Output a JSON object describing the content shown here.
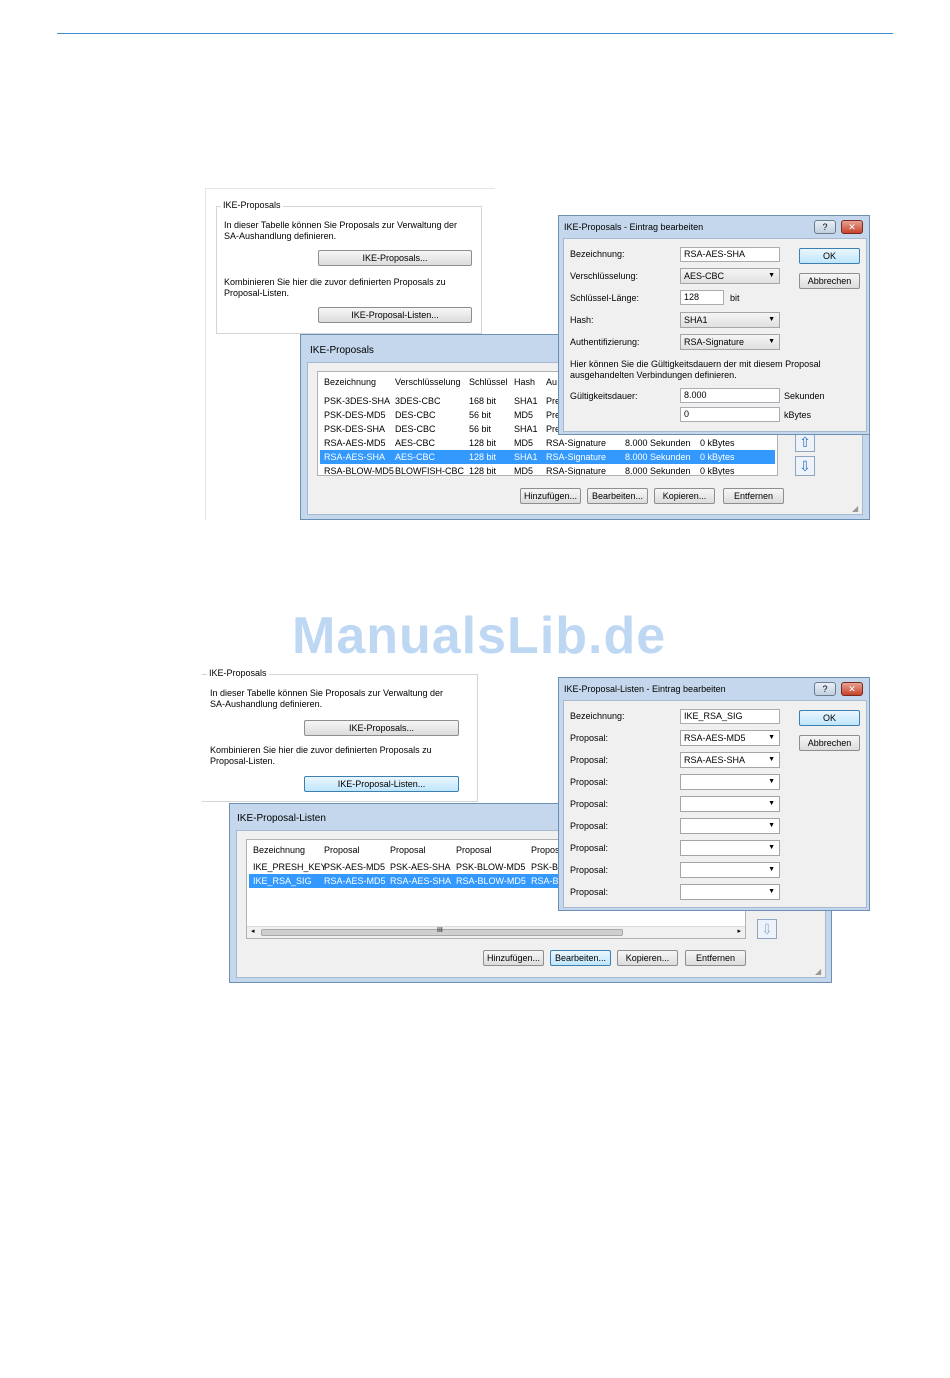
{
  "watermark": "ManualsLib.de",
  "fig1": {
    "group_title": "IKE-Proposals",
    "desc1": "In dieser Tabelle können Sie Proposals zur Verwaltung der SA-Aushandlung definieren.",
    "btn_proposals": "IKE-Proposals...",
    "desc2": "Kombinieren Sie hier die zuvor definierten Proposals zu Proposal-Listen.",
    "btn_lists": "IKE-Proposal-Listen...",
    "list_window": {
      "title": "IKE-Proposals",
      "headers": [
        "Bezeichnung",
        "Verschlüsselung",
        "Schlüssel",
        "Hash",
        "Au"
      ],
      "rows": [
        {
          "c": [
            "PSK-3DES-SHA",
            "3DES-CBC",
            "168 bit",
            "SHA1",
            "Pre",
            "",
            ""
          ]
        },
        {
          "c": [
            "PSK-DES-MD5",
            "DES-CBC",
            "56 bit",
            "MD5",
            "Pre",
            "",
            ""
          ]
        },
        {
          "c": [
            "PSK-DES-SHA",
            "DES-CBC",
            "56 bit",
            "SHA1",
            "Pre",
            "",
            ""
          ]
        },
        {
          "c": [
            "RSA-AES-MD5",
            "AES-CBC",
            "128 bit",
            "MD5",
            "RSA-Signature",
            "8.000 Sekunden",
            "0 kBytes"
          ]
        },
        {
          "c": [
            "RSA-AES-SHA",
            "AES-CBC",
            "128 bit",
            "SHA1",
            "RSA-Signature",
            "8.000 Sekunden",
            "0 kBytes"
          ],
          "selected": true
        },
        {
          "c": [
            "RSA-BLOW-MD5",
            "BLOWFISH-CBC",
            "128 bit",
            "MD5",
            "RSA-Signature",
            "8.000 Sekunden",
            "0 kBytes"
          ]
        }
      ],
      "btn_add": "Hinzufügen...",
      "btn_edit": "Bearbeiten...",
      "btn_copy": "Kopieren...",
      "btn_remove": "Entfernen"
    },
    "edit_window": {
      "title": "IKE-Proposals - Eintrag bearbeiten",
      "help": "?",
      "close": "✕",
      "label_name": "Bezeichnung:",
      "value_name": "RSA-AES-SHA",
      "label_enc": "Verschlüsselung:",
      "value_enc": "AES-CBC",
      "label_keylen": "Schlüssel-Länge:",
      "value_keylen": "128",
      "unit_keylen": "bit",
      "label_hash": "Hash:",
      "value_hash": "SHA1",
      "label_auth": "Authentifizierung:",
      "value_auth": "RSA-Signature",
      "info": "Hier können Sie die Gültigkeitsdauern der mit diesem Proposal ausgehandelten Verbindungen definieren.",
      "label_validity": "Gültigkeitsdauer:",
      "value_seconds": "8.000",
      "unit_seconds": "Sekunden",
      "value_kbytes": "0",
      "unit_kbytes": "kBytes",
      "btn_ok": "OK",
      "btn_cancel": "Abbrechen"
    }
  },
  "fig2": {
    "group_title": "IKE-Proposals",
    "desc1": "In dieser Tabelle können Sie Proposals zur Verwaltung der SA-Aushandlung definieren.",
    "btn_proposals": "IKE-Proposals...",
    "desc2": "Kombinieren Sie hier die zuvor definierten Proposals zu Proposal-Listen.",
    "btn_lists": "IKE-Proposal-Listen...",
    "list_window": {
      "title": "IKE-Proposal-Listen",
      "headers": [
        "Bezeichnung",
        "Proposal",
        "Proposal",
        "Proposal",
        "Propos"
      ],
      "rows": [
        {
          "c": [
            "IKE_PRESH_KEY",
            "PSK-AES-MD5",
            "PSK-AES-SHA",
            "PSK-BLOW-MD5",
            "PSK-BL"
          ]
        },
        {
          "c": [
            "IKE_RSA_SIG",
            "RSA-AES-MD5",
            "RSA-AES-SHA",
            "RSA-BLOW-MD5",
            "RSA-BL"
          ],
          "selected": true
        }
      ],
      "scroll_grip": "III",
      "btn_add": "Hinzufügen...",
      "btn_edit": "Bearbeiten...",
      "btn_copy": "Kopieren...",
      "btn_remove": "Entfernen"
    },
    "edit_window": {
      "title": "IKE-Proposal-Listen - Eintrag bearbeiten",
      "help": "?",
      "close": "✕",
      "label_name": "Bezeichnung:",
      "value_name": "IKE_RSA_SIG",
      "proposal_label": "Proposal:",
      "proposals": [
        "RSA-AES-MD5",
        "RSA-AES-SHA",
        "",
        "",
        "",
        "",
        "",
        ""
      ],
      "btn_ok": "OK",
      "btn_cancel": "Abbrechen"
    }
  }
}
